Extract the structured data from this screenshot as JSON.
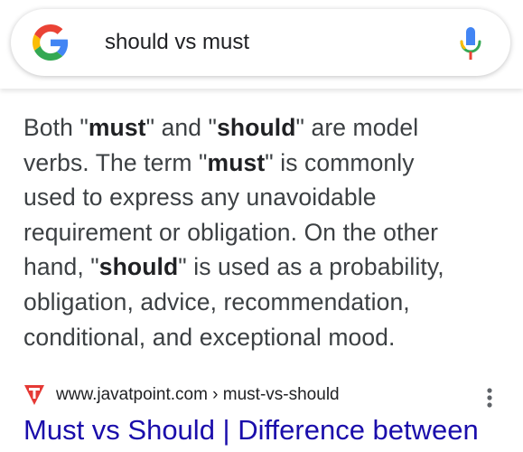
{
  "search": {
    "query": "should vs must"
  },
  "snippet": {
    "lines": [
      [
        {
          "t": "Both \"",
          "b": false
        },
        {
          "t": "must",
          "b": true
        },
        {
          "t": "\" and \"",
          "b": false
        },
        {
          "t": "should",
          "b": true
        },
        {
          "t": "\" are model",
          "b": false
        }
      ],
      [
        {
          "t": "verbs. The term \"",
          "b": false
        },
        {
          "t": "must",
          "b": true
        },
        {
          "t": "\" is commonly",
          "b": false
        }
      ],
      [
        {
          "t": "used to express any unavoidable",
          "b": false
        }
      ],
      [
        {
          "t": "requirement or obligation. On the other",
          "b": false
        }
      ],
      [
        {
          "t": "hand, \"",
          "b": false
        },
        {
          "t": "should",
          "b": true
        },
        {
          "t": "\" is used as a probability,",
          "b": false
        }
      ],
      [
        {
          "t": "obligation, advice, recommendation,",
          "b": false
        }
      ],
      [
        {
          "t": "conditional, and exceptional mood.",
          "b": false
        }
      ]
    ]
  },
  "result": {
    "source_url": "www.javatpoint.com › must-vs-should",
    "title": "Must vs Should | Difference between"
  },
  "icons": {
    "logo": "google-g-logo",
    "mic": "microphone-icon",
    "favicon": "javatpoint-favicon",
    "more": "more-vert-icon"
  },
  "colors": {
    "link": "#1a0dab",
    "text": "#3c4043",
    "favicon_red": "#e53935",
    "google_blue": "#4285F4",
    "google_red": "#EA4335",
    "google_yellow": "#FBBC05",
    "google_green": "#34A853"
  }
}
